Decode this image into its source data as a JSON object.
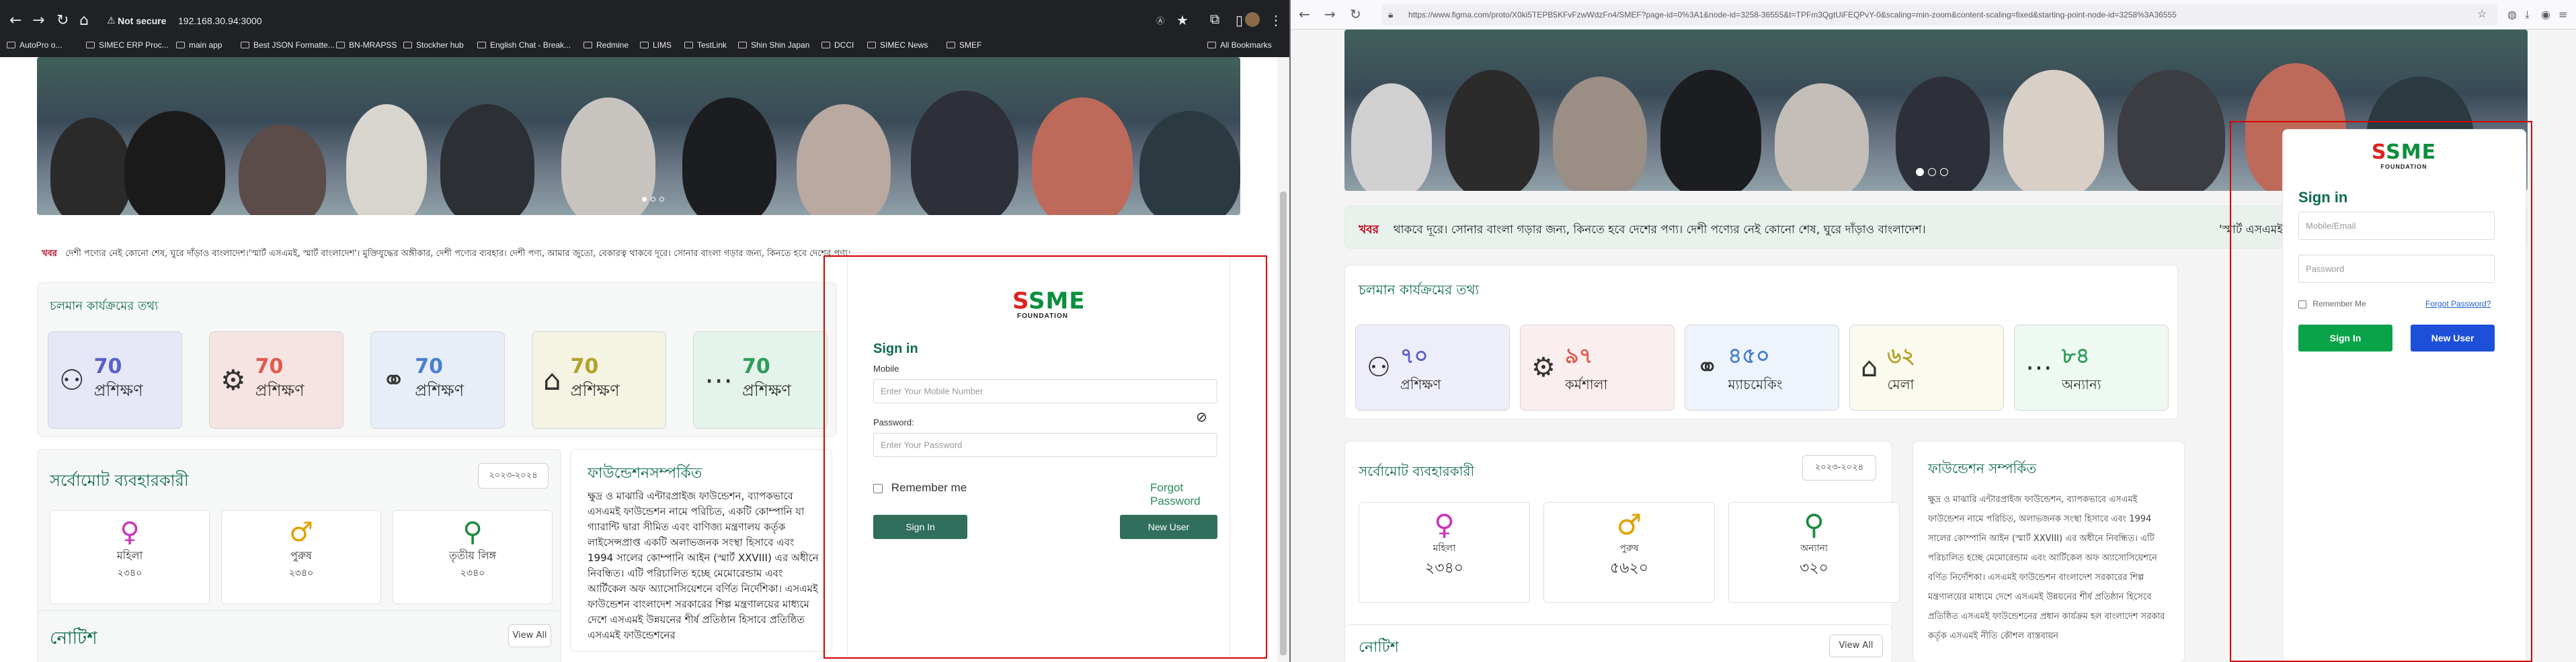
{
  "left": {
    "address_security": "Not secure",
    "address_url": "192.168.30.94:3000",
    "bookmarks": [
      "AutoPro o...",
      "SIMEC ERP Proc...",
      "main app",
      "Best JSON Formatte...",
      "BN-MRAPSS",
      "Stockher hub",
      "English Chat - Break...",
      "Redmine",
      "LIMS",
      "TestLink",
      "Shin Shin Japan",
      "DCCI",
      "SIMEC News",
      "SMEF"
    ],
    "all_bookmarks": "All Bookmarks",
    "ticker_label": "খবর",
    "ticker_text": "দেশী পণ্যের নেই কোনো শেষ, ঘুরে দাঁড়াও বাংলাদেশ।'স্মার্ট এসএমই, স্মার্ট বাংলাদেশ'। মুক্তিযুদ্ধের অঙ্গীকার, দেশী পণ্যের ব্যবহার। দেশী পণ্য, আমার জুতো, বেকারত্ব থাকবে দূরে। সোনার বাংলা গড়ার জন্য, কিনতে হবে দেশের পণ্য।",
    "program_title": "চলমান কার্যক্রমের তথ্য",
    "tiles": [
      {
        "num": "70",
        "label": "প্রশিক্ষণ",
        "bg": "#e6e7f7",
        "color": "#5a5fc9",
        "icon": "training-icon"
      },
      {
        "num": "70",
        "label": "প্রশিক্ষণ",
        "bg": "#f6e4e2",
        "color": "#e05a4e",
        "icon": "workshop-icon"
      },
      {
        "num": "70",
        "label": "প্রশিক্ষণ",
        "bg": "#e7eef8",
        "color": "#4a7fd0",
        "icon": "matchmaking-icon"
      },
      {
        "num": "70",
        "label": "প্রশিক্ষণ",
        "bg": "#f5f3e2",
        "color": "#b3a12a",
        "icon": "fair-icon"
      },
      {
        "num": "70",
        "label": "প্রশিক্ষণ",
        "bg": "#e5f4ea",
        "color": "#2c9c5a",
        "icon": "other-icon"
      }
    ],
    "users_title": "সর্বোমোট ব্যবহারকারী",
    "users_year": "২০২৩-২০২৪",
    "users": [
      {
        "symbol": "♀",
        "label": "মহিলা",
        "count": "২৩৪০",
        "color": "#c936b5"
      },
      {
        "symbol": "♂",
        "label": "পুরুষ",
        "count": "২৩৪০",
        "color": "#e0a100"
      },
      {
        "symbol": "⚲",
        "label": "তৃতীয় লিঙ্গ",
        "count": "২৩৪০",
        "color": "#1b8a3c"
      }
    ],
    "about_title": "ফাউন্ডেশনসম্পর্কিত",
    "about_text": "ক্ষুদ্র ও মাঝারি এন্টারপ্রাইজ ফাউন্ডেশন, ব্যাপকভাবে এসএমই ফাউন্ডেশন নামে পরিচিত, একটি কোম্পানি যা গ্যারান্টি দ্বারা সীমিত এবং বাণিজ্য মন্ত্রণালয় কর্তৃক লাইসেন্সপ্রাপ্ত একটি অলাভজনক সংস্থা হিসাবে এবং 1994 সালের কোম্পানি আইন (স্মার্ট XXVIII) এর অধীনে নিবন্ধিত। এটি পরিচালিত হচ্ছে মেমোরেন্ডাম এবং আর্টিকেল অফ অ্যাসোসিয়েশনে বর্ণিত নির্দেশিকা। এসএমই ফাউন্ডেশন বাংলাদেশ সরকারের শিল্প মন্ত্রণালয়ের মাধ্যমে দেশে এসএমই উন্নয়নের শীর্ষ প্রতিষ্ঠান হিসাবে প্রতিষ্ঠিত এসএমই ফাউন্ডেশনের",
    "notice_title": "নোটিশ",
    "view_all": "View All",
    "login": {
      "logo_text": "SME",
      "logo_sub": "FOUNDATION",
      "title": "Sign in",
      "mobile_label": "Mobile",
      "mobile_placeholder": "Enter Your Mobile Number",
      "password_label": "Password:",
      "password_placeholder": "Enter Your Password",
      "remember": "Remember me",
      "forgot": "Forgot Password",
      "signin": "Sign In",
      "newuser": "New User"
    }
  },
  "right": {
    "address_url": "https://www.figma.com/proto/X0ki5TEPB5KFvFzwWdzFn4/SMEF?page-id=0%3A1&node-id=3258-36555&t=TPFm3QgtUiFEQPvY-0&scaling=min-zoom&content-scaling=fixed&starting-point-node-id=3258%3A36555",
    "ticker_label": "খবর",
    "ticker_text": "থাকবে দূরে। সোনার বাংলা গড়ার জন্য, কিনতে হবে দেশের পণ্য। দেশী পণ্যের নেই কোনো শেষ, ঘুরে দাঁড়াও বাংলাদেশ।",
    "ticker_text2": "'স্মার্ট এসএমই, স্মার্ট বাংলাদেশ'। মুক্তিযুদ্ধের অঙ্গীকার, দেশী পণ্য",
    "program_title": "চলমান কার্যক্রমের তথ্য",
    "tiles": [
      {
        "num": "৭০",
        "label": "প্রশিক্ষণ",
        "bg": "#eeeefb",
        "color": "#5a5fc9",
        "icon": "training-icon"
      },
      {
        "num": "৯৭",
        "label": "কর্মশালা",
        "bg": "#fbeeee",
        "color": "#e05a4e",
        "icon": "workshop-icon"
      },
      {
        "num": "৪৫০",
        "label": "ম্যাচমেকিং",
        "bg": "#eef4fb",
        "color": "#4a7fd0",
        "icon": "matchmaking-icon"
      },
      {
        "num": "৬২",
        "label": "মেলা",
        "bg": "#fbfaee",
        "color": "#b3a12a",
        "icon": "fair-icon"
      },
      {
        "num": "৮৪",
        "label": "অন্যান্য",
        "bg": "#eef9f1",
        "color": "#2c9c5a",
        "icon": "other-icon"
      }
    ],
    "users_title": "সর্বোমোট ব্যবহারকারী",
    "users_year": "২০২৩-২০২৪",
    "users": [
      {
        "symbol": "♀",
        "label": "মহিলা",
        "count": "২৩৪০",
        "color": "#c936b5"
      },
      {
        "symbol": "♂",
        "label": "পুরুষ",
        "count": "৫৬২০",
        "color": "#e0a100"
      },
      {
        "symbol": "⚲",
        "label": "অন্যান্য",
        "count": "৩২০",
        "color": "#1b8a3c"
      }
    ],
    "about_title": "ফাউন্ডেশন সম্পর্কিত",
    "about_text": "ক্ষুদ্র ও মাঝারি এন্টারপ্রাইজ ফাউন্ডেশন, ব্যাপকভাবে এসএমই ফাউন্ডেশন নামে পরিচিত, অলাভজনক সংস্থা হিসাবে এবং 1994 সালের কোম্পানি আইন (স্মার্ট XXVIII) এর অধীনে নিবন্ধিত। এটি পরিচালিত হচ্ছে মেমোরেন্ডাম এবং আর্টিকেল অফ অ্যাসোসিয়েশনে বর্ণিত নির্দেশিকা। এসএমই ফাউন্ডেশন বাংলাদেশ সরকারের শিল্প মন্ত্রণালয়ের মাধ্যমে দেশে এসএমই উন্নয়নের শীর্ষ প্রতিষ্ঠান হিসেবে প্রতিষ্ঠিত এসএমই ফাউন্ডেশনের প্রধান কার্যক্রম হল বাংলাদেশ সরকার কর্তৃক এসএমই নীতি কৌশল বাস্তবায়ন",
    "notice_title": "নোটিশ",
    "view_all": "View All",
    "login": {
      "logo_text": "SME",
      "logo_sub": "FOUNDATION",
      "title": "Sign in",
      "mobile_placeholder": "Mobile/Email",
      "password_placeholder": "Password",
      "remember": "Remember Me",
      "forgot": "Forgot Password?",
      "signin": "Sign In",
      "newuser": "New User"
    }
  }
}
